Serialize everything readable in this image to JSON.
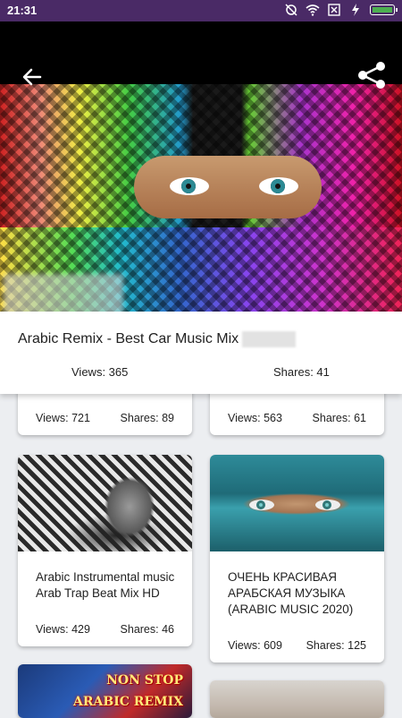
{
  "status_bar": {
    "time": "21:31"
  },
  "video": {
    "title": "Arabic Remix - Best Car Music Mix",
    "views": "Views: 365",
    "shares": "Shares: 41"
  },
  "cards": [
    {
      "views": "Views: 721",
      "shares": "Shares: 89"
    },
    {
      "views": "Views: 563",
      "shares": "Shares: 61"
    },
    {
      "title": "Arabic Instrumental music Arab Trap Beat Mix HD",
      "views": "Views: 429",
      "shares": "Shares: 46"
    },
    {
      "title": "ОЧЕНЬ КРАСИВАЯ АРАБСКАЯ МУЗЫКА (ARABIC MUSIC 2020)",
      "views": "Views: 609",
      "shares": "Shares: 125"
    },
    {
      "thumb_text_1": "NON STOP",
      "thumb_text_2": "ARABIC REMIX"
    },
    {}
  ],
  "icons": {
    "back": "arrow-back-icon",
    "share": "share-icon",
    "battery": "battery-icon"
  },
  "colors": {
    "status_bar": "#4a2a66",
    "background": "#eceef1",
    "battery": "#4caf50"
  }
}
